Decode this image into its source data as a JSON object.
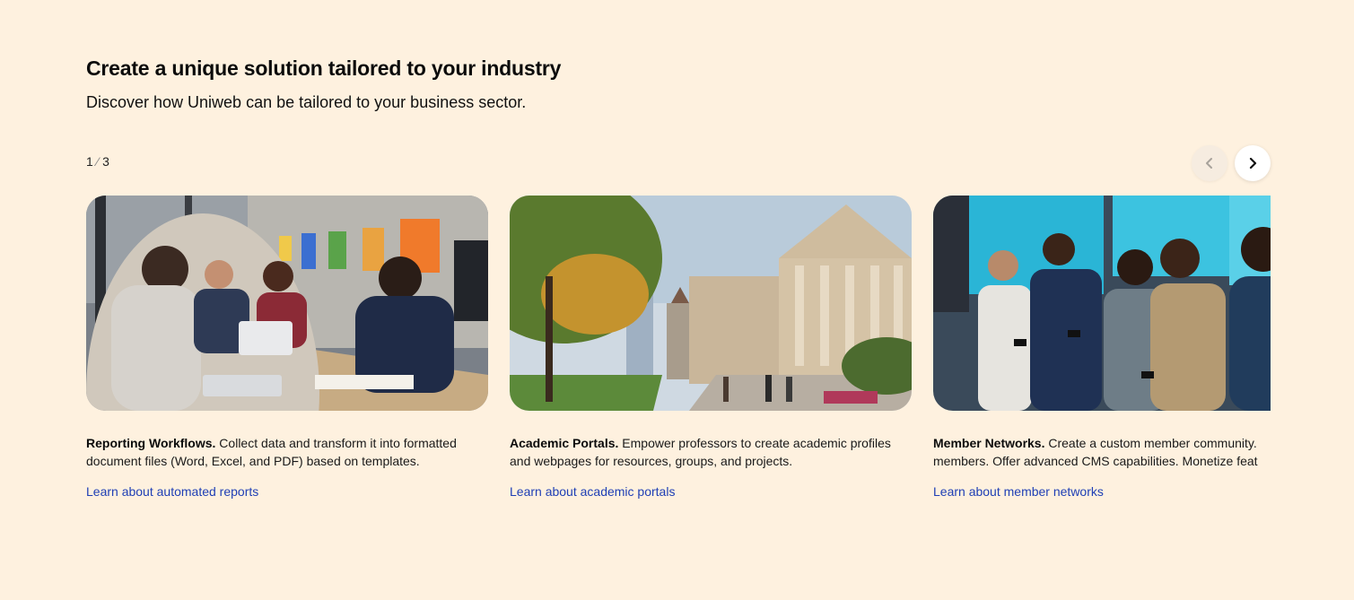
{
  "header": {
    "title": "Create a unique solution tailored to your industry",
    "subtitle": "Discover how Uniweb can be tailored to your business sector."
  },
  "pager": {
    "current": "1",
    "separator": "⁄",
    "total": "3",
    "prev_icon": "chevron-left-icon",
    "next_icon": "chevron-right-icon"
  },
  "cards": [
    {
      "image": "office-meeting-photo",
      "title": "Reporting Workflows.",
      "line1": " Collect data and transform it into formatted",
      "line2": "document files (Word, Excel, and PDF) based on templates.",
      "link": "Learn about automated reports"
    },
    {
      "image": "university-campus-photo",
      "title": "Academic Portals.",
      "line1": " Empower professors to create academic profiles",
      "line2": "and webpages for resources, groups, and projects.",
      "link": "Learn about academic portals"
    },
    {
      "image": "networking-event-photo",
      "title": "Member Networks.",
      "line1": " Create a custom member community.",
      "line2": "members. Offer advanced CMS capabilities. Monetize feat",
      "link": "Learn about member networks"
    }
  ],
  "colors": {
    "background": "#fef1df",
    "link": "#1f3fb5"
  }
}
